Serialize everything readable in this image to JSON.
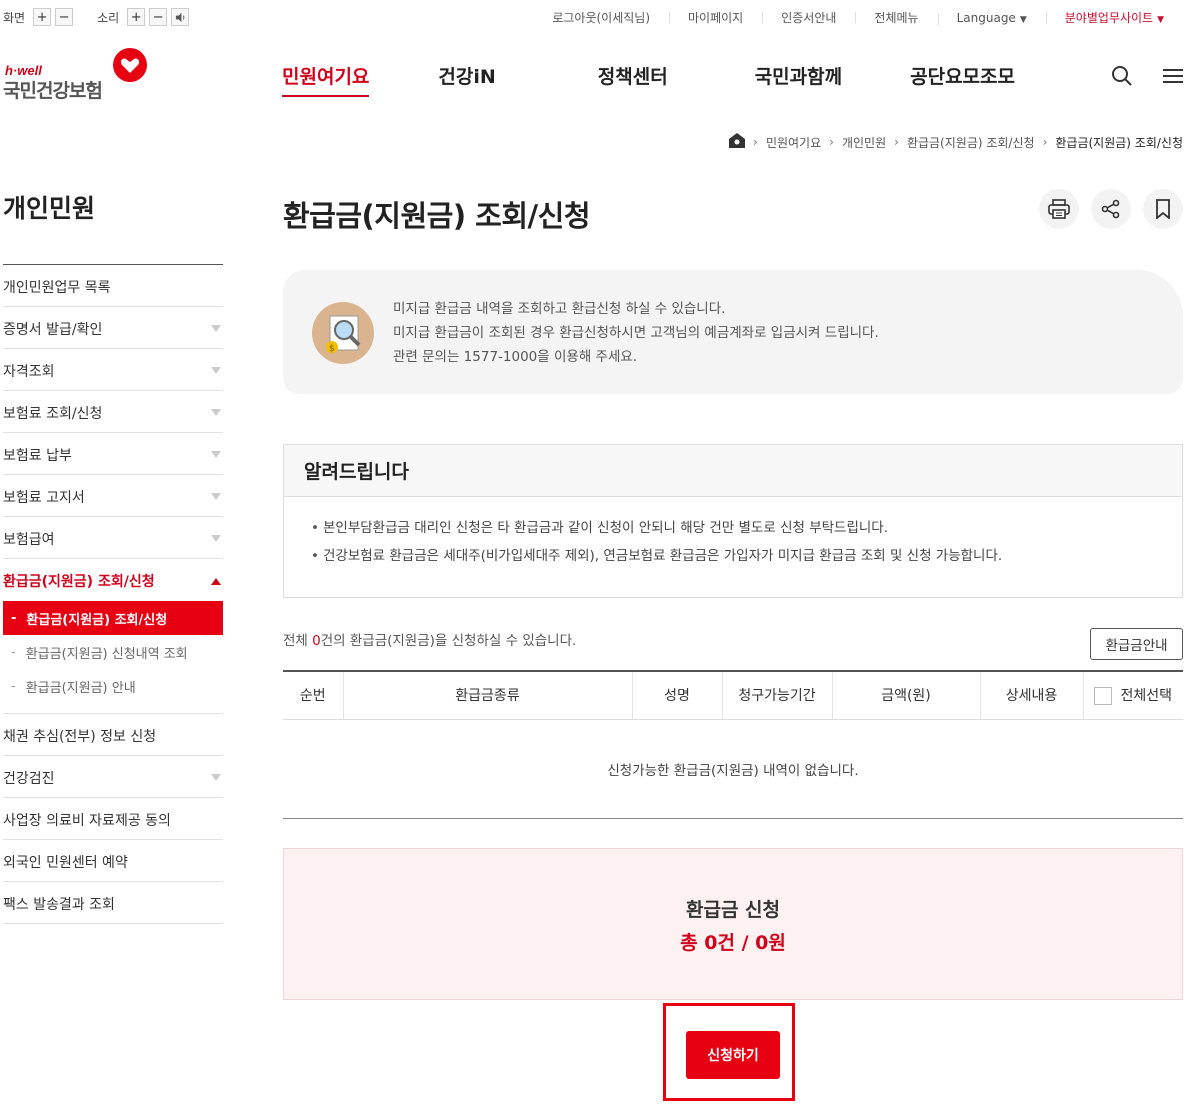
{
  "util": {
    "screen_label": "화면",
    "sound_label": "소리",
    "plus": "+",
    "minus": "−",
    "links": [
      "로그아웃(이세직님)",
      "마이페이지",
      "인증서안내",
      "전체메뉴"
    ],
    "language": "Language",
    "field_site": "분야별업무사이트"
  },
  "logo": {
    "tagline": "h·well",
    "name": "국민건강보험"
  },
  "gnb": [
    "민원여기요",
    "건강iN",
    "정책센터",
    "국민과함께",
    "공단요모조모"
  ],
  "breadcrumb": [
    "민원여기요",
    "개인민원",
    "환급금(지원금) 조회/신청",
    "환급금(지원금) 조회/신청"
  ],
  "sidebar": {
    "title": "개인민원",
    "items": [
      {
        "label": "개인민원업무 목록",
        "arrow": false
      },
      {
        "label": "증명서 발급/확인",
        "arrow": true
      },
      {
        "label": "자격조회",
        "arrow": true
      },
      {
        "label": "보험료 조회/신청",
        "arrow": true
      },
      {
        "label": "보험료 납부",
        "arrow": true
      },
      {
        "label": "보험료 고지서",
        "arrow": true
      },
      {
        "label": "보험급여",
        "arrow": true
      },
      {
        "label": "환급금(지원금) 조회/신청",
        "arrow": true,
        "open": true
      },
      {
        "label": "채권 추심(전부) 정보 신청",
        "arrow": false
      },
      {
        "label": "건강검진",
        "arrow": true
      },
      {
        "label": "사업장 의료비 자료제공 동의",
        "arrow": false
      },
      {
        "label": "외국인 민원센터 예약",
        "arrow": false
      },
      {
        "label": "팩스 발송결과 조회",
        "arrow": false
      }
    ],
    "subitems": [
      "환급금(지원금) 조회/신청",
      "환급금(지원금) 신청내역 조회",
      "환급금(지원금) 안내"
    ]
  },
  "page_title": "환급금(지원금) 조회/신청",
  "intro_lines": [
    "미지급 환급금 내역을 조회하고 환급신청 하실 수 있습니다.",
    "미지급 환급금이 조회된 경우 환급신청하시면 고객님의 예금계좌로 입금시켜 드립니다.",
    "관련 문의는 1577-1000을 이용해 주세요."
  ],
  "notice": {
    "title": "알려드립니다",
    "items": [
      "본인부담환급금 대리인 신청은 타 환급금과 같이 신청이 안되니 해당 건만 별도로 신청 부탁드립니다.",
      "건강보험료 환급금은 세대주(비가입세대주 제외), 연금보험료 환급금은 가입자가 미지급 환급금 조회 및 신청 가능합니다."
    ]
  },
  "count": {
    "prefix": "전체 ",
    "num": "0",
    "suffix": "건의 환급금(지원금)을 신청하실 수 있습니다."
  },
  "guide_button": "환급금안내",
  "table": {
    "headers": [
      "순번",
      "환급금종류",
      "성명",
      "청구가능기간",
      "금액(원)",
      "상세내용",
      "전체선택"
    ],
    "empty": "신청가능한 환급금(지원금) 내역이 없습니다."
  },
  "summary": {
    "title": "환급금 신청",
    "total": "총 0건 / 0원"
  },
  "apply_button": "신청하기",
  "colors": {
    "brand_red": "#e60012",
    "text_red": "#d0021b"
  }
}
